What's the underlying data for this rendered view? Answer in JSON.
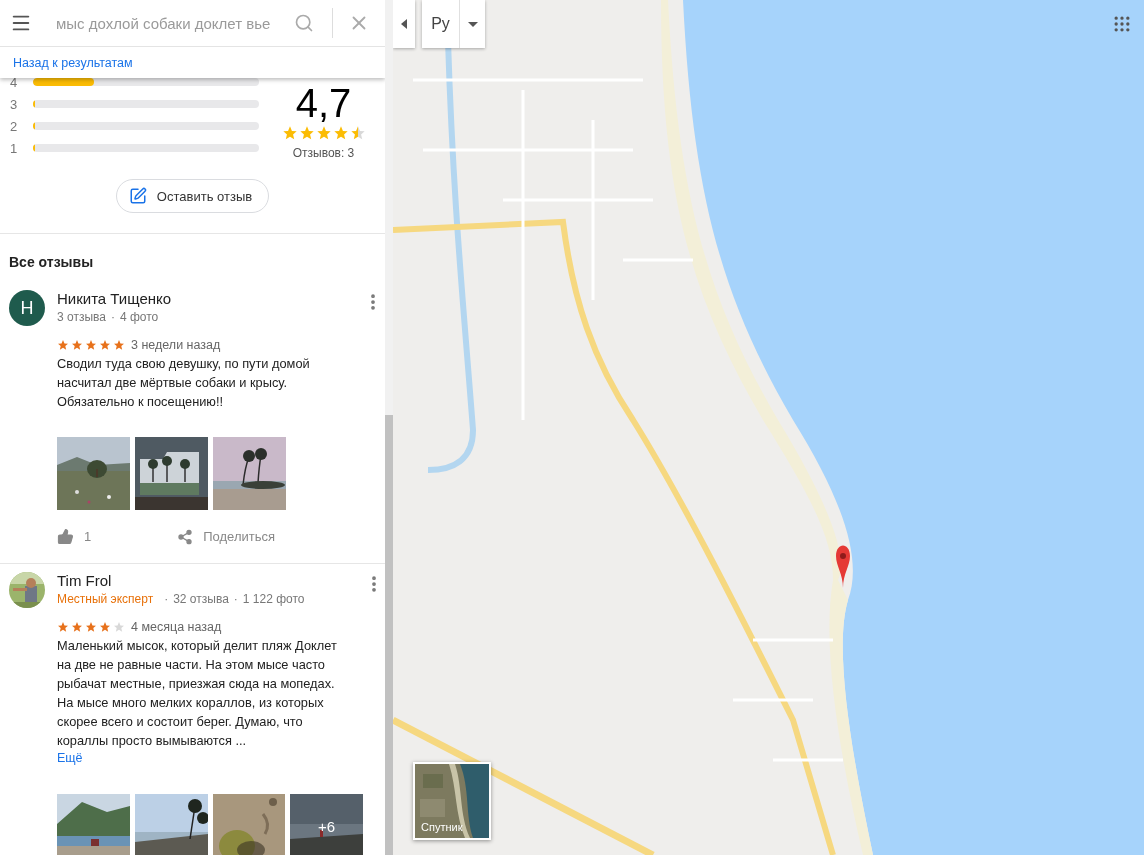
{
  "search": {
    "value": "мыс дохлой собаки доклет вье",
    "back_link": "Назад к результатам"
  },
  "rating": {
    "histogram": [
      {
        "label": "4",
        "level": 0.27
      },
      {
        "label": "3",
        "level": 0.01
      },
      {
        "label": "2",
        "level": 0.01
      },
      {
        "label": "1",
        "level": 0.01
      }
    ],
    "score": "4,7",
    "stars": 4.5,
    "count": "Отзывов: 3"
  },
  "write_review_button": "Оставить отзыв",
  "reviews_heading": "Все отзывы",
  "reviews": [
    {
      "author": "Никита Тищенко",
      "avatar": {
        "kind": "letter",
        "letter": "Н"
      },
      "meta": [
        "3 отзыва",
        "4 фото"
      ],
      "separator": "·",
      "stars": 5,
      "time": "3 недели назад",
      "text": "Сводил туда свою девушку, по пути домой насчитал две мёртвые собаки и крысу. Обязательно к посещению!!",
      "photos": [
        {
          "kind": "picture"
        },
        {
          "kind": "picture"
        },
        {
          "kind": "picture"
        }
      ],
      "likes": "1",
      "share": "Поделиться"
    },
    {
      "author": "Tim Frol",
      "avatar": {
        "kind": "picture"
      },
      "badge": "Местный эксперт",
      "meta": [
        "32 отзыва",
        "1 122 фото"
      ],
      "separator": "·",
      "stars": 4,
      "time": "4 месяца назад",
      "text": "Маленький мысок, который делит пляж Доклет на две не равные части. На этом мысе часто рыбачат местные, приезжая сюда на мопедах. На мысе много мелких кораллов, из которых скорее всего и состоит берег. Думаю, что кораллы просто вымываются ...",
      "more": "Ещё",
      "photos": [
        {
          "kind": "picture"
        },
        {
          "kind": "picture"
        },
        {
          "kind": "picture"
        },
        {
          "kind": "picture"
        }
      ],
      "extra_photos": "+6"
    }
  ],
  "map": {
    "kind": "picture",
    "language_button": "Ру",
    "satellite_button": "Спутник"
  }
}
